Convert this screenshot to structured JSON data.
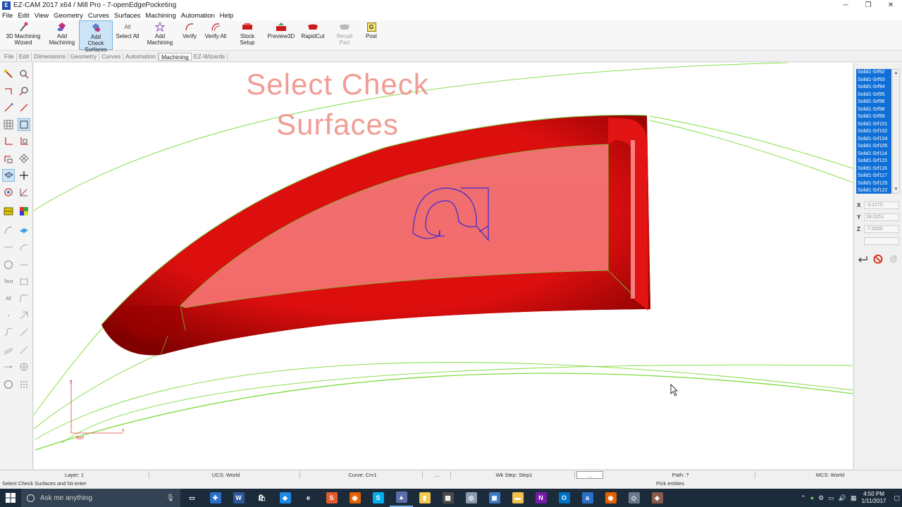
{
  "window": {
    "title": "EZ-CAM 2017 x64 / Mill Pro  -  7-openEdgePocketing",
    "minimize": "─",
    "restore": "❐",
    "close": "✕"
  },
  "menu": [
    "File",
    "Edit",
    "View",
    "Geometry",
    "Curves",
    "Surfaces",
    "Machining",
    "Automation",
    "Help"
  ],
  "ribbon": {
    "buttons": [
      {
        "label": "3D Machining\nWizard",
        "icon": "wizard-icon"
      },
      {
        "label": "Add\nMachining",
        "icon": "add-machining-icon"
      },
      {
        "label": "Add Check\nSurfaces",
        "icon": "add-check-surfaces-icon"
      },
      {
        "label": "Select All",
        "icon": "select-all-icon",
        "icon_text": "All"
      },
      {
        "label": "Add\nMachining",
        "icon": "add-machining-star-icon"
      },
      {
        "label": "Verify",
        "icon": "verify-icon"
      },
      {
        "label": "Verify All",
        "icon": "verify-all-icon"
      },
      {
        "label": "Stock Setup",
        "icon": "stock-setup-icon"
      },
      {
        "label": "Preview3D",
        "icon": "preview3d-icon"
      },
      {
        "label": "RapidCut",
        "icon": "rapidcut-icon"
      },
      {
        "label": "Recall Part",
        "icon": "recall-part-icon"
      },
      {
        "label": "Post",
        "icon": "post-icon",
        "icon_text": "G"
      }
    ]
  },
  "tabs": [
    "File",
    "Edit",
    "Dimensions",
    "Geometry",
    "Curves",
    "Automation",
    "Machining",
    "EZ-Wizards"
  ],
  "left_toolbar": {
    "text_tool": "Text",
    "all_tool": "All"
  },
  "viewport": {
    "overlay_title_line1": "Select Check",
    "overlay_title_line2": "Surfaces",
    "part_label": "2",
    "axis_label": "Ref",
    "surface_color": "#e00000",
    "wire_color": "#7ddc3c"
  },
  "surface_list": {
    "items": [
      "Solid1-Srf92",
      "Solid1-Srf93",
      "Solid1-Srf94",
      "Solid1-Srf95",
      "Solid1-Srf96",
      "Solid1-Srf98",
      "Solid1-Srf99",
      "Solid1-Srf101",
      "Solid1-Srf102",
      "Solid1-Srf104",
      "Solid1-Srf105",
      "Solid1-Srf114",
      "Solid1-Srf115",
      "Solid1-Srf116",
      "Solid1-Srf117",
      "Solid1-Srf120",
      "Solid1-Srf122"
    ],
    "selected_color": "#0f6fd6"
  },
  "coords": {
    "x_label": "X",
    "x_value": "-3.2175",
    "y_label": "Y",
    "y_value": "28.0251",
    "z_label": "Z",
    "z_value": "-7.2000"
  },
  "status": {
    "layer": "Layer: 1",
    "ucs": "UCS: World",
    "curve": "Curve: Crv1",
    "dots1": "...",
    "wkstep": "Wk Step: Step1",
    "dots2": "...",
    "path": "Path: ?",
    "mcs": "MCS: World"
  },
  "prompt": {
    "left": "Select Check Surfaces and hit enter",
    "right": "Pick entities"
  },
  "taskbar": {
    "search_placeholder": "Ask me anything",
    "apps": [
      {
        "icon": "task-view-icon",
        "color": "#1c2b3a",
        "text": "▭"
      },
      {
        "icon": "ezcam-taskbar-icon",
        "color": "#2a6fc9",
        "text": "✚"
      },
      {
        "icon": "word-icon",
        "color": "#2b579a",
        "text": "W"
      },
      {
        "icon": "store-icon",
        "color": "#1c2b3a",
        "text": "🛍"
      },
      {
        "icon": "app-blue-icon",
        "color": "#1e88e5",
        "text": "◆"
      },
      {
        "icon": "edge-icon",
        "color": "#1c2b3a",
        "text": "e"
      },
      {
        "icon": "snagit-icon",
        "color": "#e35b2b",
        "text": "S"
      },
      {
        "icon": "firefox-icon",
        "color": "#e66000",
        "text": "◉"
      },
      {
        "icon": "skype-icon",
        "color": "#00aff0",
        "text": "S"
      },
      {
        "icon": "ezcam-active-icon",
        "color": "#5b6ea8",
        "text": "▲"
      },
      {
        "icon": "sticky-notes-icon",
        "color": "#f2c94c",
        "text": "▮"
      },
      {
        "icon": "calculator-icon",
        "color": "#4a4a4a",
        "text": "▦"
      },
      {
        "icon": "disc-icon",
        "color": "#8a9bb0",
        "text": "◎"
      },
      {
        "icon": "photos-icon",
        "color": "#3a78c2",
        "text": "▣"
      },
      {
        "icon": "folder-icon",
        "color": "#f0c24b",
        "text": "▬"
      },
      {
        "icon": "onenote-icon",
        "color": "#7719aa",
        "text": "N"
      },
      {
        "icon": "outlook-icon",
        "color": "#0072c6",
        "text": "O"
      },
      {
        "icon": "app-act-icon",
        "color": "#2a6fc9",
        "text": "a"
      },
      {
        "icon": "firefox2-icon",
        "color": "#e66000",
        "text": "◉"
      },
      {
        "icon": "ezcam2-icon",
        "color": "#6b7a8a",
        "text": "◇"
      },
      {
        "icon": "ezcam3-icon",
        "color": "#8a5a4a",
        "text": "◈"
      }
    ],
    "time": "4:50 PM",
    "date": "1/11/2017"
  }
}
